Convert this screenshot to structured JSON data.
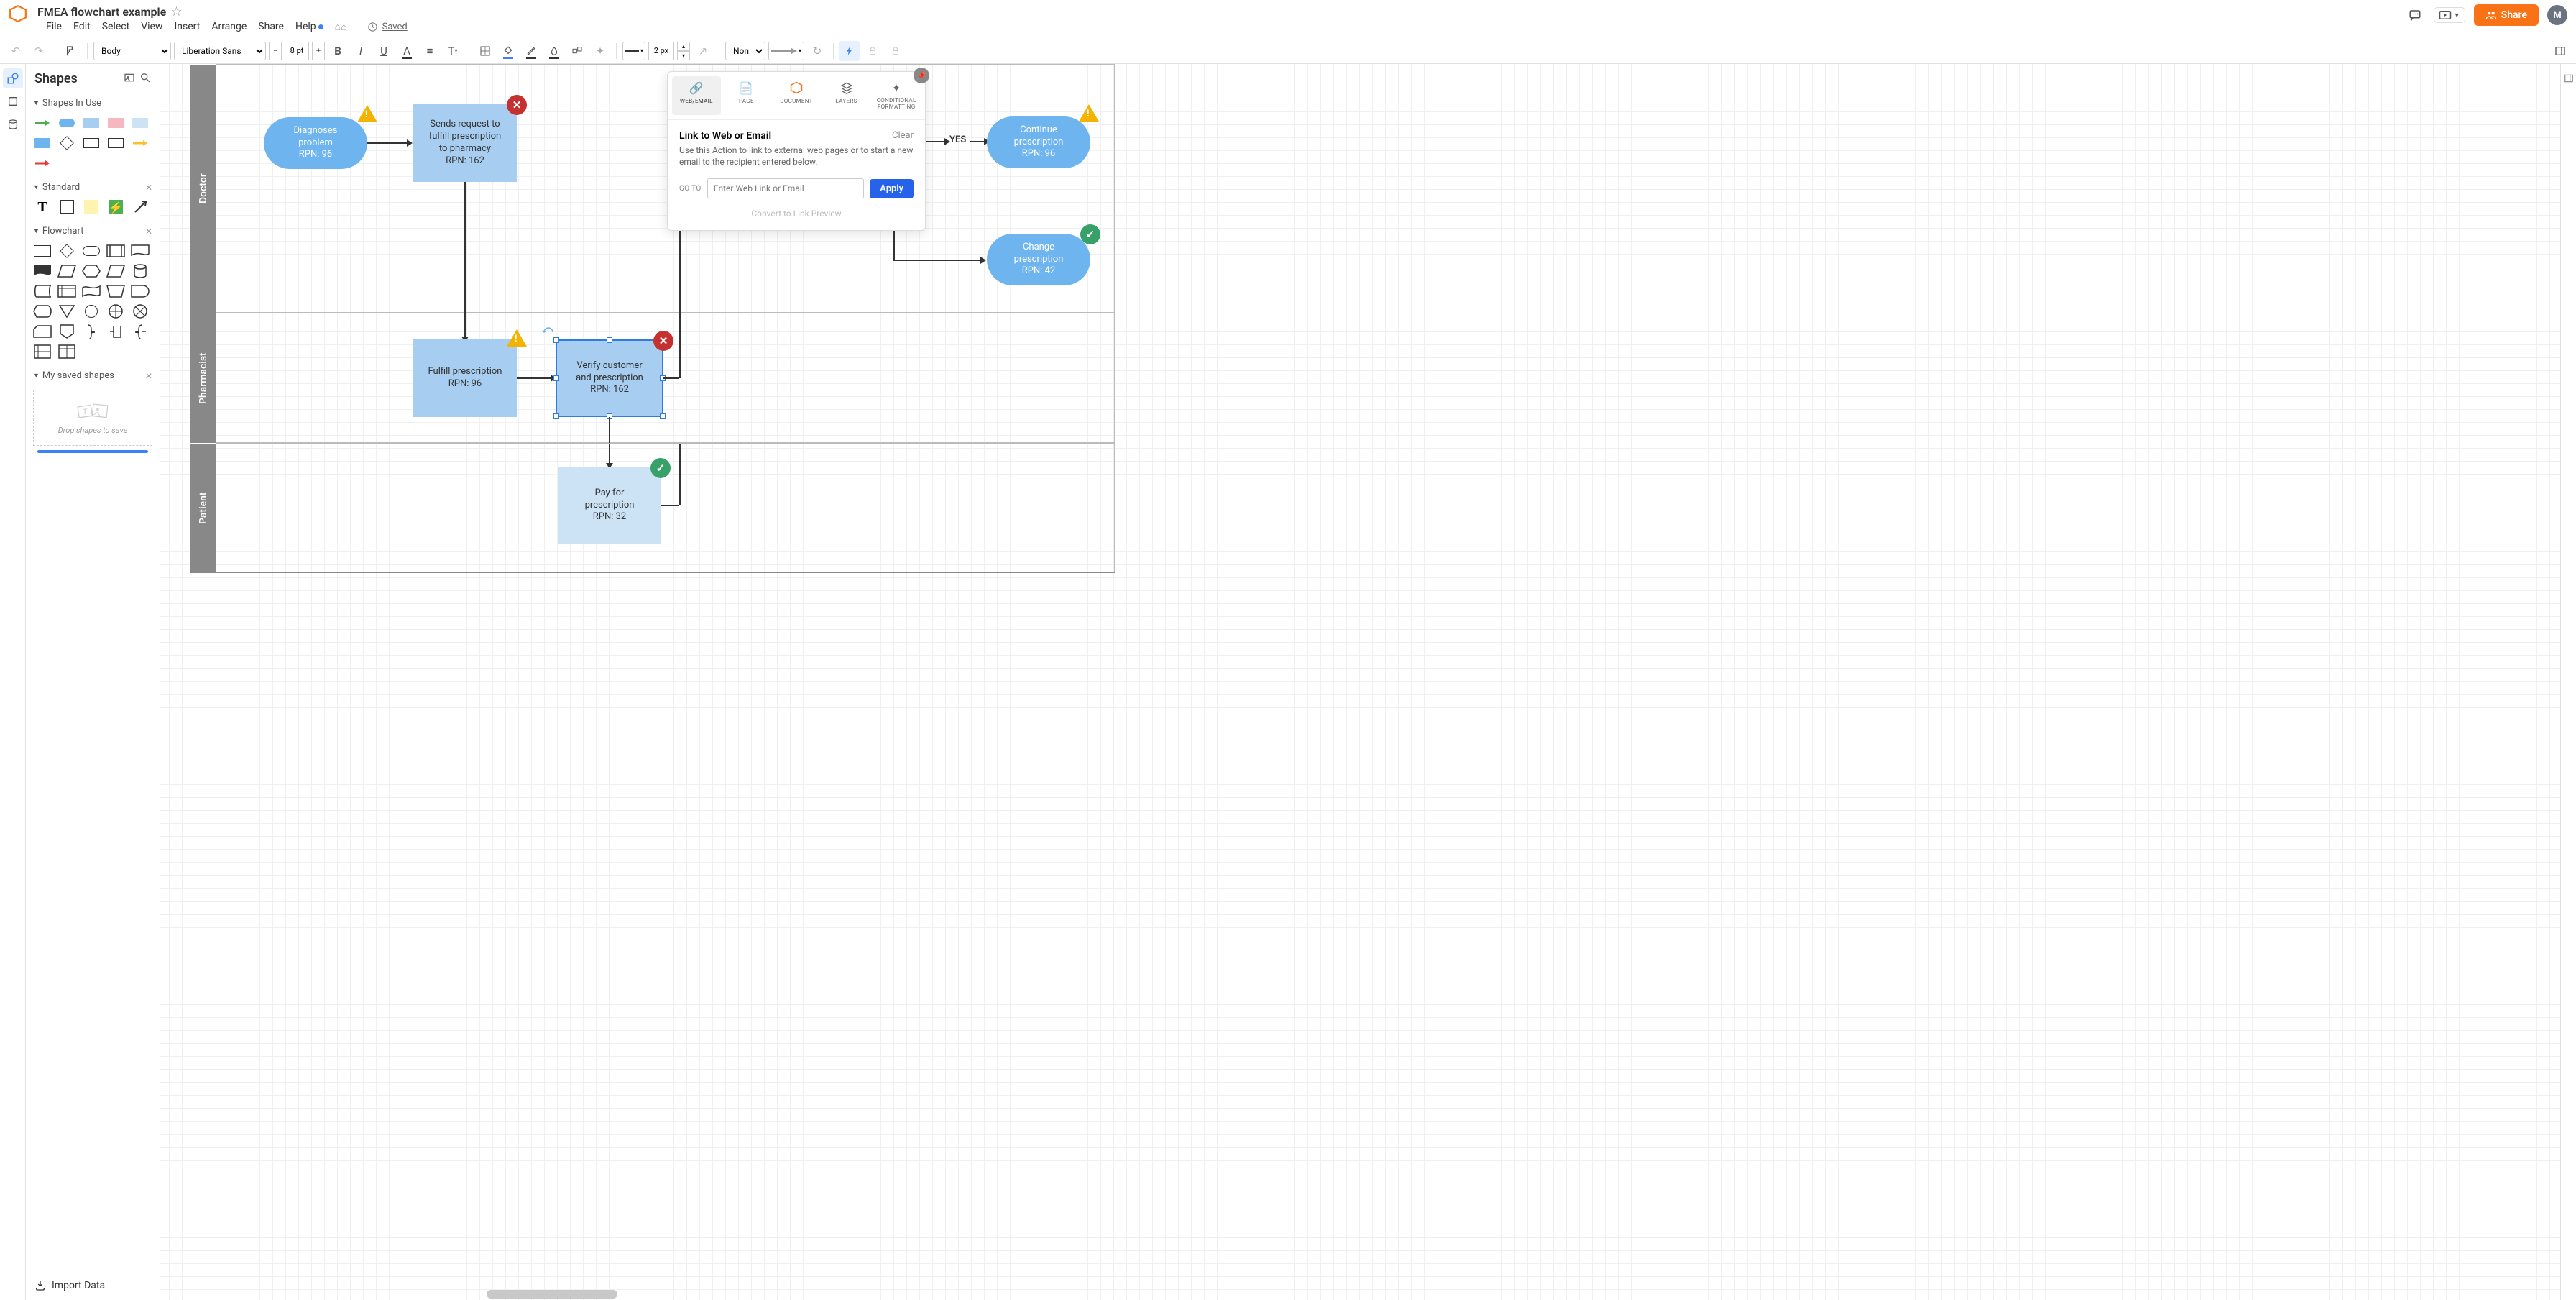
{
  "header": {
    "title": "FMEA flowchart example",
    "menu": [
      "File",
      "Edit",
      "Select",
      "View",
      "Insert",
      "Arrange",
      "Share",
      "Help"
    ],
    "saved": "Saved",
    "share_label": "Share",
    "avatar_letter": "M"
  },
  "toolbar": {
    "font_family_btn": "Body ",
    "font_family": "Liberation Sans",
    "font_size": "8 pt",
    "stroke_width": "2 px",
    "endpoint_none": "None"
  },
  "shapes_panel": {
    "title": "Shapes",
    "sections": {
      "in_use": "Shapes In Use",
      "standard": "Standard",
      "flowchart": "Flowchart",
      "saved": "My saved shapes"
    },
    "saved_drop_hint": "Drop shapes to save",
    "import_data": "Import Data"
  },
  "canvas": {
    "lanes": [
      "Doctor",
      "Pharmacist",
      "Patient"
    ],
    "nodes": {
      "diagnose": {
        "l1": "Diagnoses",
        "l2": "problem",
        "l3": "RPN: 96"
      },
      "send_req": {
        "l1": "Sends request to",
        "l2": "fulfill prescription",
        "l3": "to pharmacy",
        "l4": "RPN: 162"
      },
      "continue": {
        "l1": "Continue",
        "l2": "prescription",
        "l3": "RPN: 96"
      },
      "change": {
        "l1": "Change",
        "l2": "prescription",
        "l3": "RPN: 42"
      },
      "fulfill": {
        "l1": "Fulfill prescription",
        "l2": "RPN: 96"
      },
      "verify": {
        "l1": "Verify customer",
        "l2": "and prescription",
        "l3": "RPN: 162"
      },
      "pay": {
        "l1": "Pay for",
        "l2": "prescription",
        "l3": "RPN: 32"
      }
    },
    "yes_label": "YES"
  },
  "actions_panel": {
    "tabs": [
      "WEB/EMAIL",
      "PAGE",
      "DOCUMENT",
      "LAYERS",
      "CONDITIONAL FORMATTING"
    ],
    "title": "Link to Web or Email",
    "clear": "Clear",
    "description": "Use this Action to link to external web pages or to start a new email to the recipient entered below.",
    "goto_label": "GO TO",
    "input_placeholder": "Enter Web Link or Email",
    "apply": "Apply",
    "convert": "Convert to Link Preview"
  }
}
